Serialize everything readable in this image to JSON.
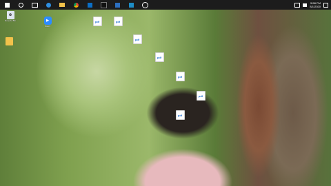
{
  "taskbar": {
    "icons": [
      "start-icon",
      "search-icon",
      "task-view-icon",
      "edge-icon",
      "file-explorer-icon",
      "chrome-icon",
      "store-icon",
      "media-icon",
      "files-icon",
      "photos-icon",
      "settings-icon"
    ],
    "clock": {
      "time": "5:58 PM",
      "date": "8/1/2020"
    }
  },
  "desktop": {
    "icons": [
      {
        "label": "Recycle Bin",
        "type": "recycle"
      },
      {
        "label": "Zoom",
        "type": "zoom"
      },
      {
        "label": "",
        "type": "folder"
      },
      {
        "label": "",
        "type": "pdf"
      },
      {
        "label": "",
        "type": "pdf"
      },
      {
        "label": "",
        "type": "pdf"
      },
      {
        "label": "",
        "type": "pdf"
      },
      {
        "label": "",
        "type": "pdf"
      },
      {
        "label": "",
        "type": "pdf"
      },
      {
        "label": "",
        "type": "pdf"
      }
    ]
  }
}
